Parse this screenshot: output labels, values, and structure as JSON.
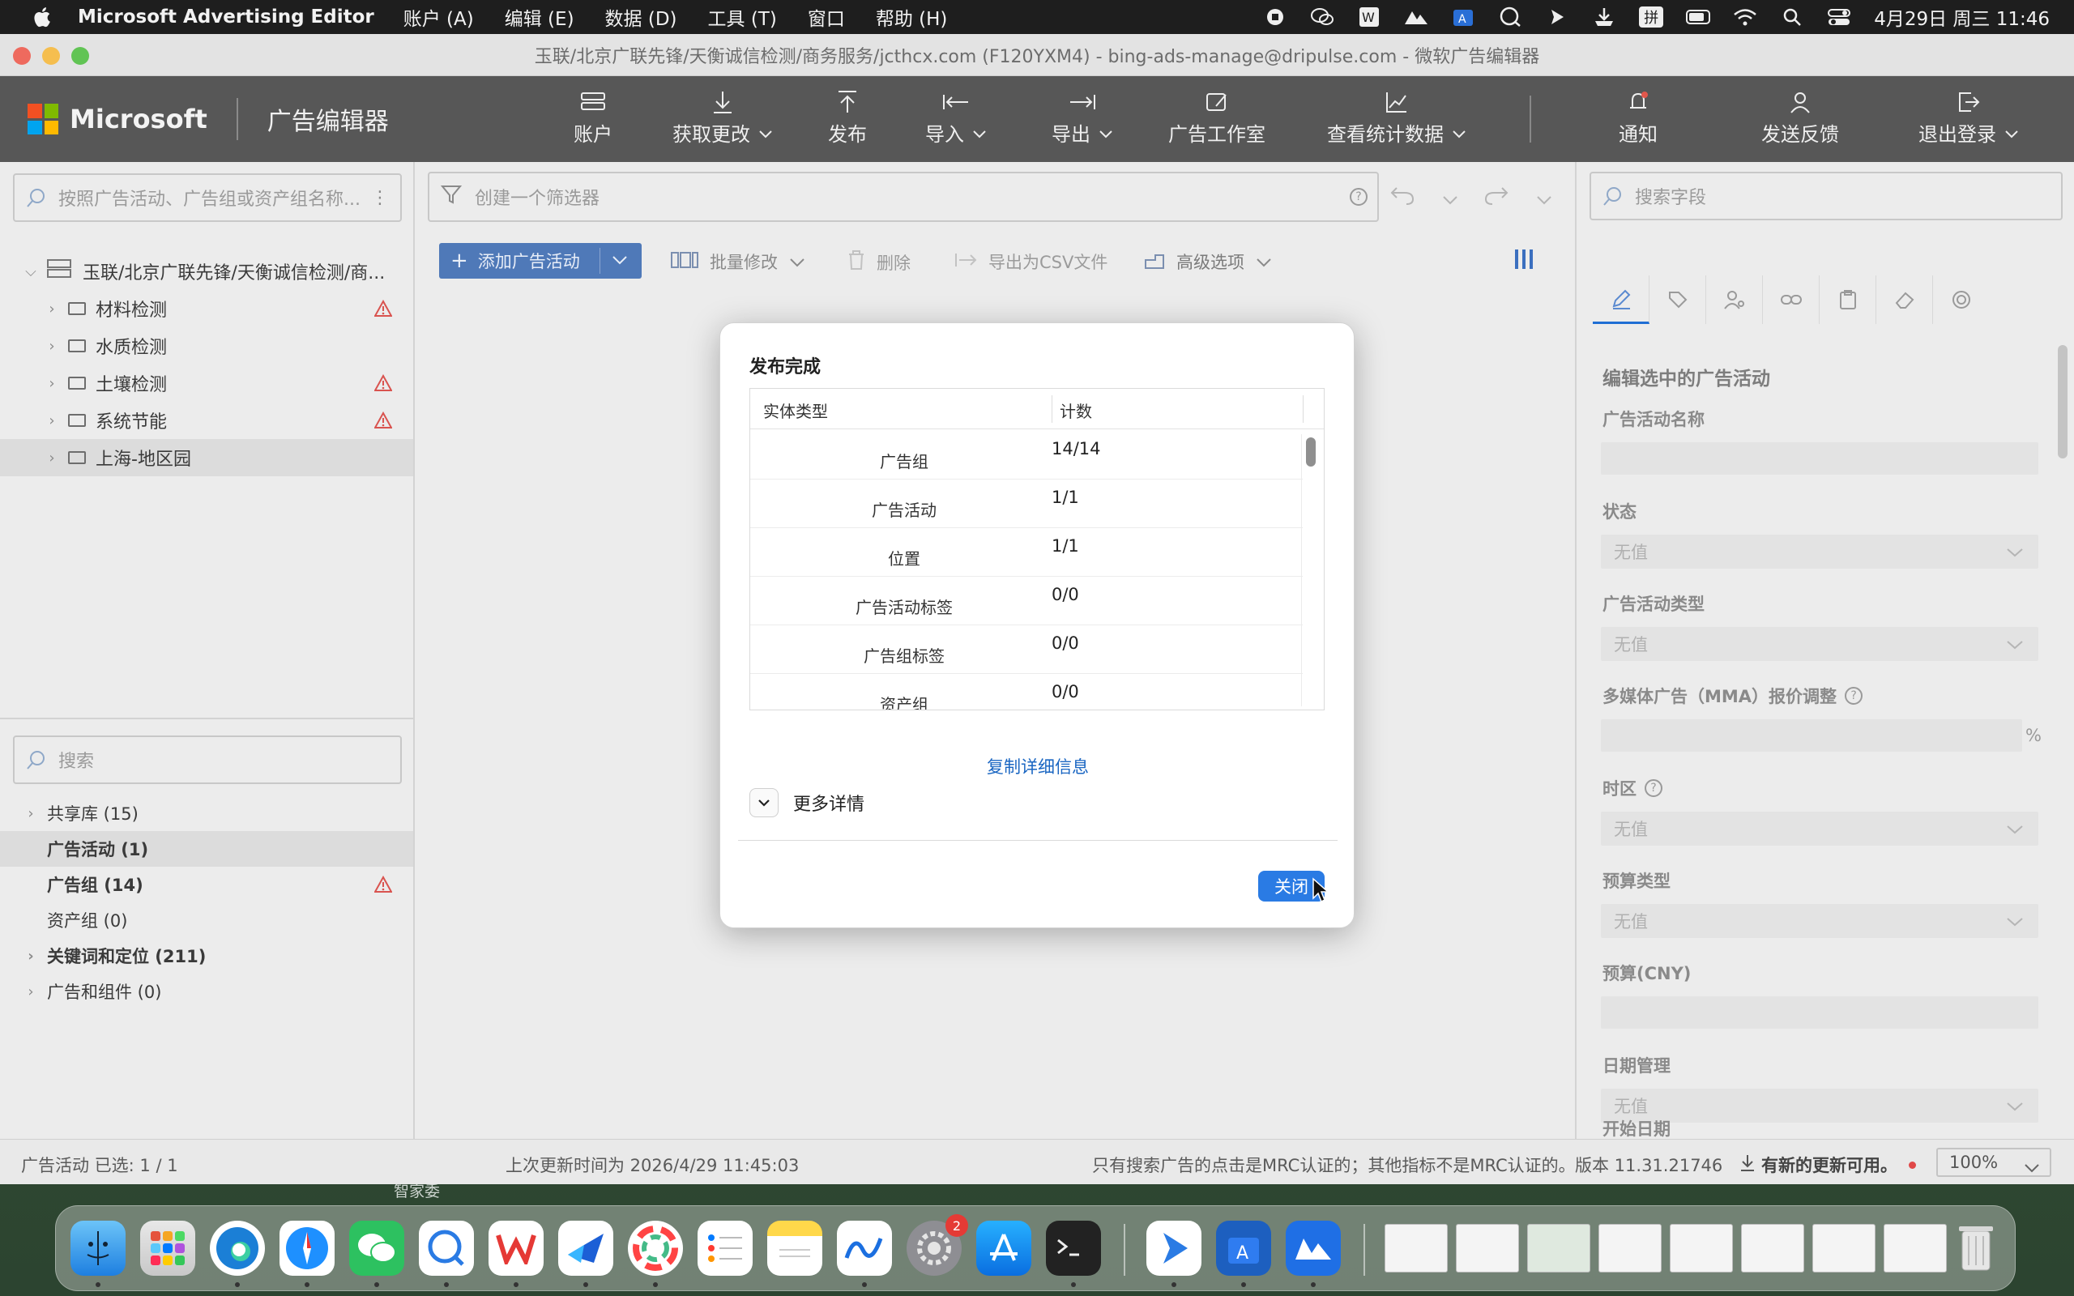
{
  "menubar": {
    "app_name": "Microsoft Advertising Editor",
    "items": [
      "账户 (A)",
      "编辑 (E)",
      "数据 (D)",
      "工具 (T)",
      "窗口",
      "帮助 (H)"
    ],
    "clock": "4月29日 周三  11:46",
    "input_method": "拼"
  },
  "window": {
    "title": "玉联/北京广联先锋/天衡诚信检测/商务服务/jcthcx.com (F120YXM4) - bing-ads-manage@dripulse.com - 微软广告编辑器"
  },
  "toolbar": {
    "brand": "Microsoft",
    "product": "广告编辑器",
    "buttons": {
      "account": "账户",
      "get_changes": "获取更改",
      "publish": "发布",
      "import": "导入",
      "export": "导出",
      "ad_studio": "广告工作室",
      "view_stats": "查看统计数据",
      "notifications": "通知",
      "feedback": "发送反馈",
      "logout": "退出登录"
    }
  },
  "left_panel": {
    "search_placeholder": "按照广告活动、广告组或资产组名称...",
    "account_node": "玉联/北京广联先锋/天衡诚信检测/商...",
    "campaigns": [
      {
        "name": "材料检测",
        "warning": true
      },
      {
        "name": "水质检测",
        "warning": false
      },
      {
        "name": "土壤检测",
        "warning": true
      },
      {
        "name": "系统节能",
        "warning": true
      },
      {
        "name": "上海-地区园",
        "warning": false
      }
    ],
    "library_search_placeholder": "搜索",
    "library": [
      {
        "label": "共享库 (15)",
        "expandable": true
      },
      {
        "label": "广告活动 (1)",
        "expandable": false
      },
      {
        "label": "广告组 (14)",
        "expandable": false
      },
      {
        "label": "资产组 (0)",
        "expandable": false
      },
      {
        "label": "关键词和定位 (211)",
        "expandable": true
      },
      {
        "label": "广告和组件 (0)",
        "expandable": true
      }
    ]
  },
  "center_panel": {
    "filter_placeholder": "创建一个筛选器",
    "add_campaign": "添加广告活动",
    "bulk_edit": "批量修改",
    "delete": "删除",
    "export_csv": "导出为CSV文件",
    "advanced": "高级选项"
  },
  "right_panel": {
    "search_placeholder": "搜索字段",
    "heading": "编辑选中的广告活动",
    "fields": {
      "campaign_name": "广告活动名称",
      "status": "状态",
      "campaign_type": "广告活动类型",
      "mma_bid": "多媒体广告（MMA）报价调整",
      "percent": "%",
      "timezone": "时区",
      "budget_type": "预算类型",
      "budget": "预算(CNY)",
      "date_mgmt": "日期管理",
      "start_date": "开始日期"
    },
    "no_value": "无值"
  },
  "dialog": {
    "title": "发布完成",
    "col_entity": "实体类型",
    "col_count": "计数",
    "rows": [
      {
        "entity": "广告组",
        "count": "14/14"
      },
      {
        "entity": "广告活动",
        "count": "1/1"
      },
      {
        "entity": "位置",
        "count": "1/1"
      },
      {
        "entity": "广告活动标签",
        "count": "0/0"
      },
      {
        "entity": "广告组标签",
        "count": "0/0"
      },
      {
        "entity": "资产组",
        "count": "0/0"
      }
    ],
    "copy_details": "复制详细信息",
    "more_details": "更多详情",
    "close": "关闭"
  },
  "statusbar": {
    "selection": "广告活动 已选: 1 / 1",
    "last_update": "上次更新时间为 2026/4/29 11:45:03",
    "mrc_note": "只有搜索广告的点击是MRC认证的；其他指标不是MRC认证的。",
    "version": "版本 11.31.21746",
    "update_available": "有新的更新可用。",
    "zoom": "100%"
  },
  "desktop": {
    "label_behind_dock": "智家委"
  },
  "dock": {
    "settings_badge": "2"
  },
  "colors": {
    "accent": "#2a7be4",
    "toolbar_bg": "#575757",
    "warning": "#d9534f"
  }
}
